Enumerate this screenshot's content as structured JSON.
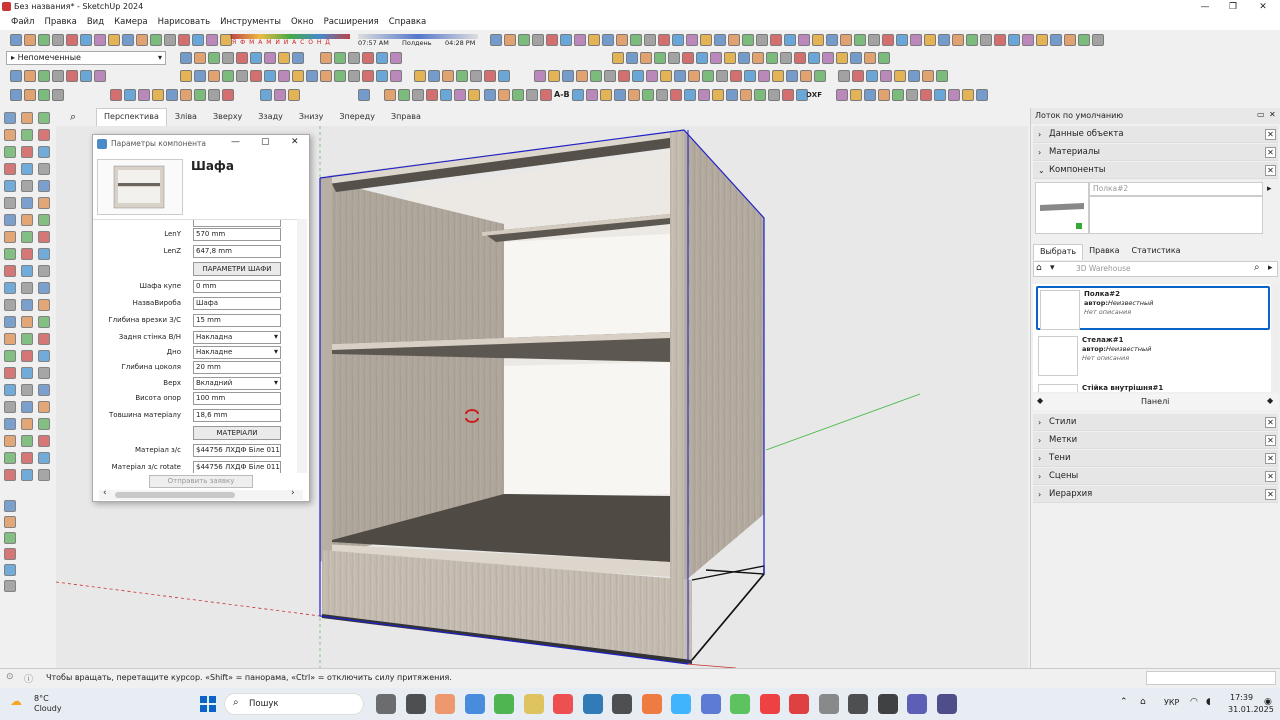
{
  "window": {
    "title": "Без названия* - SketchUp 2024",
    "min": "—",
    "max": "❐",
    "close": "✕"
  },
  "menu": [
    "Файл",
    "Правка",
    "Вид",
    "Камера",
    "Нарисовать",
    "Инструменты",
    "Окно",
    "Расширения",
    "Справка"
  ],
  "toolbar": {
    "shadow_months": "Я Ф М А М И И А С О Н Д",
    "time_start": "07:57 AM",
    "time_mid": "Полдень",
    "time_end": "04:28 PM",
    "layer_select": "Непомеченные",
    "dxf": "DXF",
    "ab": "A-B"
  },
  "view_tabs": [
    "Перспектива",
    "Зліва",
    "Зверху",
    "Ззаду",
    "Знизу",
    "Зпереду",
    "Зправа"
  ],
  "dialog": {
    "title": "Параметры компонента",
    "heading": "Шафа",
    "params": [
      {
        "label": "LenY",
        "value": "570 mm",
        "kind": "input"
      },
      {
        "label": "LenZ",
        "value": "647,8 mm",
        "kind": "input"
      },
      {
        "label": "",
        "value": "ПАРАМЕТРИ ШАФИ",
        "kind": "button"
      },
      {
        "label": "Шафа купе",
        "value": "0 mm",
        "kind": "input"
      },
      {
        "label": "НазваВироба",
        "value": "Шафа",
        "kind": "input"
      },
      {
        "label": "Глибина врезки З/С",
        "value": "15 mm",
        "kind": "input"
      },
      {
        "label": "Задня стінка В/Н",
        "value": "Накладна",
        "kind": "select"
      },
      {
        "label": "Дно",
        "value": "Накладне",
        "kind": "select"
      },
      {
        "label": "Глибина цоколя",
        "value": "20 mm",
        "kind": "input"
      },
      {
        "label": "Верх",
        "value": "Вкладний",
        "kind": "select"
      },
      {
        "label": "Висота опор",
        "value": "100 mm",
        "kind": "input"
      },
      {
        "label": "Товшина матеріалу",
        "value": "18,6 mm",
        "kind": "input"
      },
      {
        "label": "",
        "value": "МАТЕРІАЛИ",
        "kind": "button"
      },
      {
        "label": "Матеріал з/с",
        "value": "$44756 ЛХДФ Біле 0110 Kr",
        "kind": "input"
      },
      {
        "label": "Матеріал з/с rotate",
        "value": "$44756 ЛХДФ Біле 0110 Kr",
        "kind": "input"
      }
    ],
    "submit": "Отправить заявку"
  },
  "tray": {
    "title": "Лоток по умолчанию",
    "sections_top": [
      "Данные объекта",
      "Материалы",
      "Компоненты"
    ],
    "component_name_placeholder": "Полка#2",
    "tabs": [
      "Выбрать",
      "Правка",
      "Статистика"
    ],
    "search_placeholder": "3D Warehouse",
    "items": [
      {
        "name": "Полка#2",
        "author_label": "автор:",
        "author": "Неизвестный",
        "desc": "Нет описания"
      },
      {
        "name": "Стелаж#1",
        "author_label": "автор:",
        "author": "Неизвестный",
        "desc": "Нет описания"
      },
      {
        "name": "Стійка внутрішня#1",
        "author_label": "",
        "author": "",
        "desc": ""
      }
    ],
    "panel_label": "Панелі",
    "sections_bottom": [
      "Стили",
      "Метки",
      "Тени",
      "Сцены",
      "Иерархия"
    ]
  },
  "status": {
    "text": "Чтобы вращать, перетащите курсор. «Shift» = панорама, «Ctrl» = отключить силу притяжения."
  },
  "taskbar": {
    "weather_temp": "8°C",
    "weather_desc": "Cloudy",
    "search": "Пошук",
    "lang": "УКР",
    "time": "17:39",
    "date": "31.01.2025"
  },
  "colors": {
    "accent": "#0a64c8",
    "axis_green": "#3cb43c",
    "axis_red": "#c83232",
    "bbox_blue": "#2020c8"
  }
}
